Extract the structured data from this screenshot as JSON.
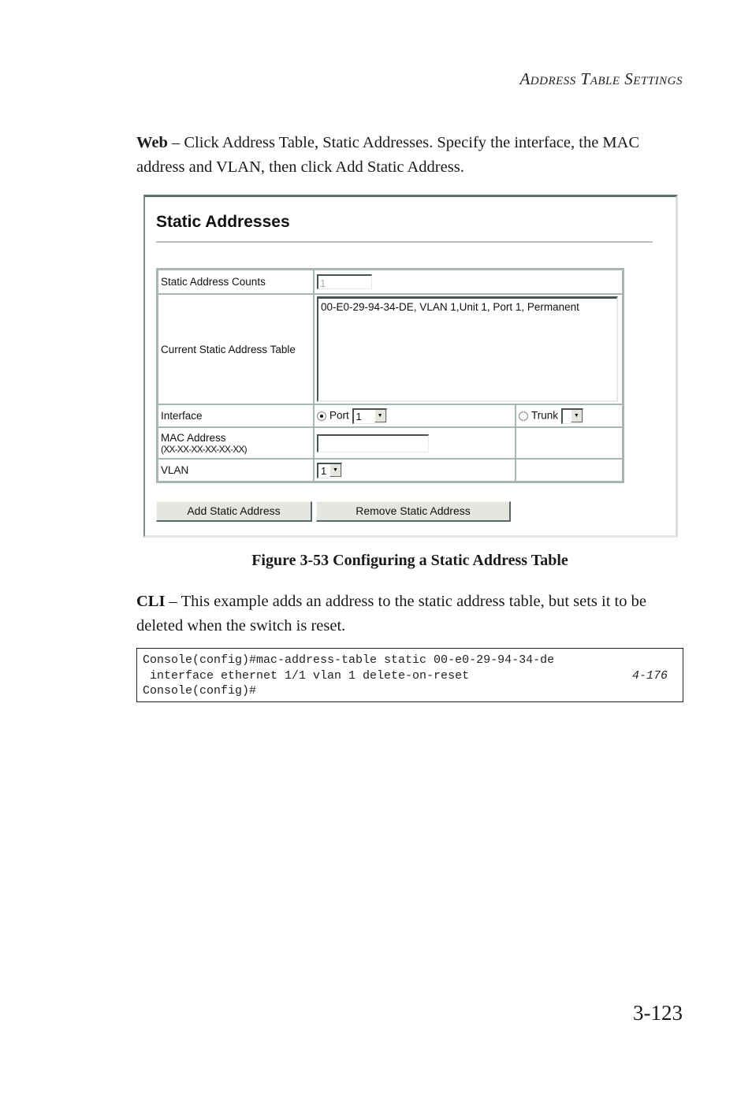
{
  "running_head": "Address Table Settings",
  "web_paragraph": {
    "lead": "Web",
    "text": " – Click Address Table, Static Addresses. Specify the interface, the MAC address and VLAN, then click Add Static Address."
  },
  "screenshot": {
    "title": "Static Addresses",
    "rows": {
      "count_label": "Static Address Counts",
      "count_value": "1",
      "table_label": "Current Static Address Table",
      "table_entries": [
        "00-E0-29-94-34-DE, VLAN 1,Unit 1, Port 1, Permanent"
      ],
      "interface_label": "Interface",
      "port_radio_label": "Port",
      "port_selected": true,
      "port_value": "1",
      "trunk_radio_label": "Trunk",
      "trunk_selected": false,
      "trunk_value": "",
      "mac_label": "MAC Address",
      "mac_format": "(XX-XX-XX-XX-XX-XX)",
      "mac_value": "",
      "vlan_label": "VLAN",
      "vlan_value": "1"
    },
    "buttons": {
      "add": "Add Static Address",
      "remove": "Remove Static Address"
    }
  },
  "figure_caption": "Figure 3-53  Configuring a Static Address Table",
  "cli_paragraph": {
    "lead": "CLI",
    "text": " – This example adds an address to the static address table, but sets it to be deleted when the switch is reset."
  },
  "code": {
    "line1": "Console(config)#mac-address-table static 00-e0-29-94-34-de",
    "line2": " interface ethernet 1/1 vlan 1 delete-on-reset",
    "line2_ref": "4-176",
    "line3": "Console(config)#"
  },
  "page_number": "3-123"
}
